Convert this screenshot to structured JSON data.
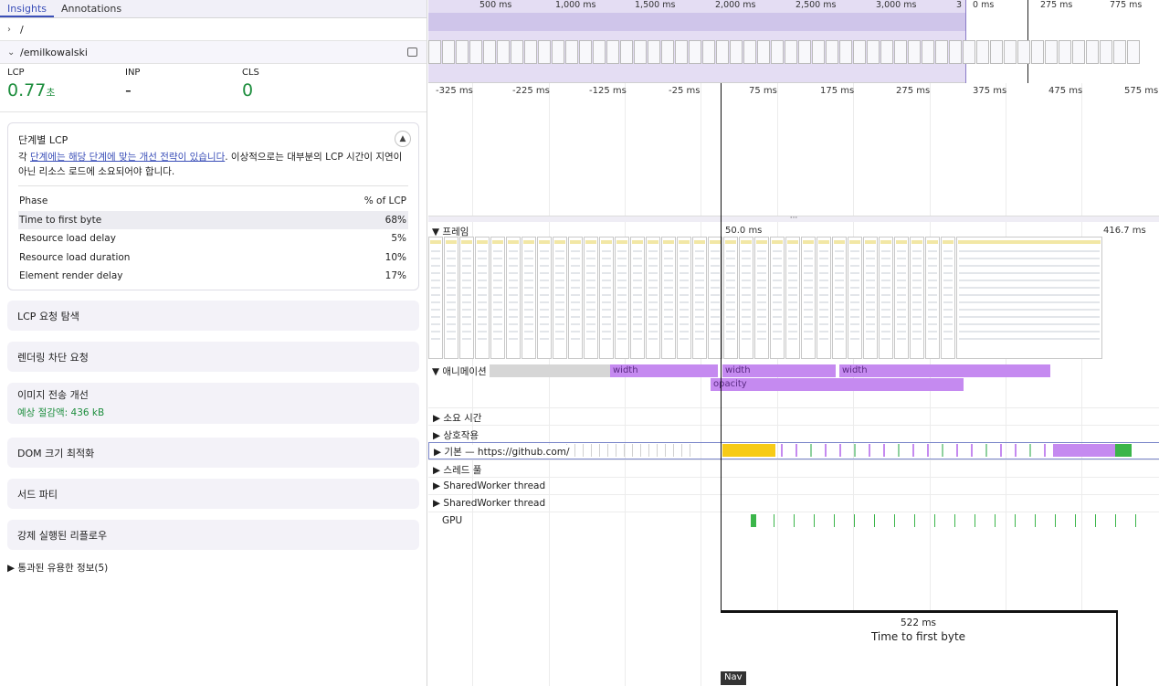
{
  "tabs": [
    "Insights",
    "Annotations"
  ],
  "crumbs": [
    "/",
    "/emilkowalski"
  ],
  "metrics": {
    "lcp": {
      "label": "LCP",
      "value": "0.77",
      "unit": "초"
    },
    "inp": {
      "label": "INP",
      "value": "-"
    },
    "cls": {
      "label": "CLS",
      "value": "0"
    }
  },
  "lcp_card": {
    "title": "단계별 LCP",
    "desc_prefix": "각 ",
    "desc_link": "단계에는 해당 단계에 맞는 개선 전략이 있습니다",
    "desc_suffix": ". 이상적으로는 대부분의 LCP 시간이 지연이 아닌 리소스 로드에 소요되어야 합니다.",
    "head_phase": "Phase",
    "head_pct": "% of LCP",
    "rows": [
      {
        "phase": "Time to first byte",
        "pct": "68%"
      },
      {
        "phase": "Resource load delay",
        "pct": "5%"
      },
      {
        "phase": "Resource load duration",
        "pct": "10%"
      },
      {
        "phase": "Element render delay",
        "pct": "17%"
      }
    ]
  },
  "sections": {
    "lcp_request": "LCP 요청 탐색",
    "render_blocking": "렌더링 차단 요청",
    "image_delivery": "이미지 전송 개선",
    "image_savings": "예상 절감액: 436 kB",
    "dom_size": "DOM 크기 최적화",
    "third_party": "서드 파티",
    "forced_reflow": "강제 실행된 리플로우",
    "passed": "통과된 유용한 정보(5)"
  },
  "overview_ticks": [
    "500 ms",
    "1,000 ms",
    "1,500 ms",
    "2,000 ms",
    "2,500 ms",
    "3,000 ms",
    "3",
    "0 ms",
    "275 ms",
    "775 ms"
  ],
  "ruler_ticks": [
    "-325 ms",
    "-225 ms",
    "-125 ms",
    "-25 ms",
    "75 ms",
    "175 ms",
    "275 ms",
    "375 ms",
    "475 ms",
    "575 ms"
  ],
  "frames_track": {
    "label": "프레임",
    "time_a": "50.0 ms",
    "time_b": "416.7 ms"
  },
  "animations": {
    "label": "애니메이션",
    "bars": [
      "width",
      "width",
      "width",
      "opacity"
    ]
  },
  "tracks": {
    "timings": "소요 시간",
    "interactions": "상호작용",
    "main": "기본 — https://github.com/",
    "thread_pool": "스레드 풀",
    "shared_worker_1": "SharedWorker thread",
    "shared_worker_2": "SharedWorker thread",
    "gpu": "GPU"
  },
  "ttfb": {
    "ms": "522 ms",
    "label": "Time to first byte"
  },
  "nav": "Nav",
  "colors": {
    "accent": "#3b4fb8",
    "good": "#1e8e3e",
    "animation": "#c58af0",
    "scripting": "#f7cb17",
    "rendering": "#c58af0",
    "painting": "#3bb54a"
  }
}
